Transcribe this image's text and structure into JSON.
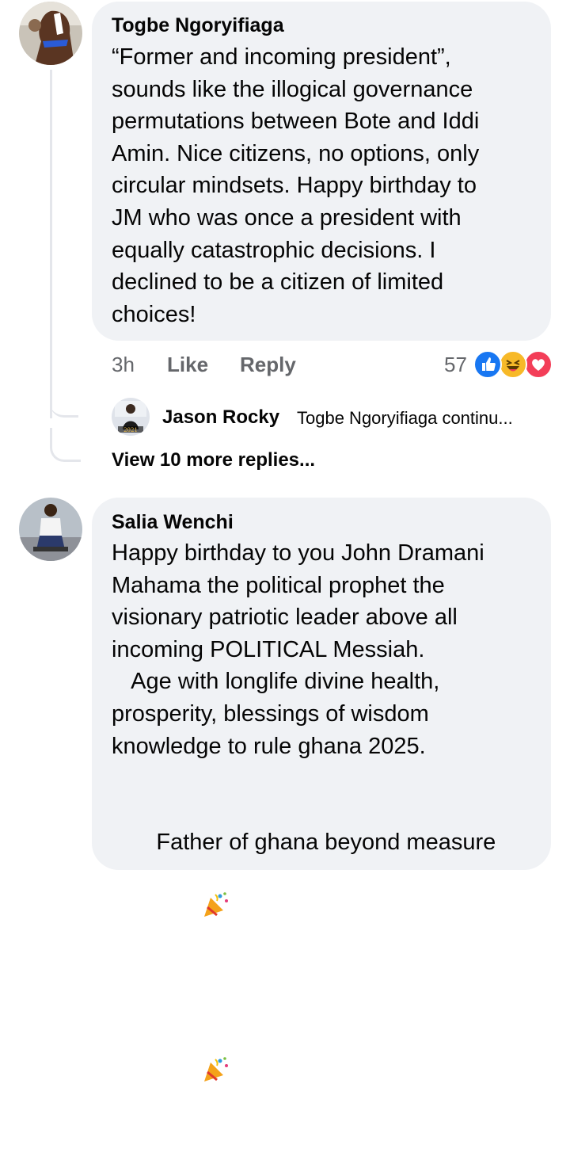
{
  "comments": [
    {
      "author": "Togbe Ngoryifiaga",
      "text": "“Former and incoming president”,\nsounds like the illogical governance\npermutations between Bote and Iddi\nAmin. Nice citizens, no options, only\ncircular mindsets. Happy birthday to\nJM who was once a president with\nequally catastrophic decisions. I\ndeclined to be a citizen of limited\nchoices!",
      "time": "3h",
      "like_label": "Like",
      "reply_label": "Reply",
      "reaction_count": "57",
      "reactions": [
        "like-icon",
        "haha-icon",
        "love-icon"
      ],
      "reply_preview": {
        "author": "Jason Rocky",
        "snippet": "Togbe Ngoryifiaga continu..."
      },
      "view_more": "View 10 more replies..."
    },
    {
      "author": "Salia Wenchi",
      "text_lines": [
        "Happy birthday to you John Dramani",
        "Mahama the political prophet the",
        "visionary patriotic leader above all",
        "incoming POLITICAL Messiah.",
        "   Age with longlife divine health,",
        "prosperity, blessings of wisdom",
        "knowledge to rule ghana 2025."
      ],
      "closing_line": " Father of ghana beyond measure",
      "emojis": [
        "party-popper-icon",
        "party-popper-icon"
      ]
    }
  ],
  "colors": {
    "bubble": "#f0f2f5",
    "meta_text": "#65676b",
    "like_blue": "#1877f2",
    "haha_yellow": "#f7b928",
    "love_red": "#f33e58",
    "thread_line": "#e4e6eb"
  }
}
